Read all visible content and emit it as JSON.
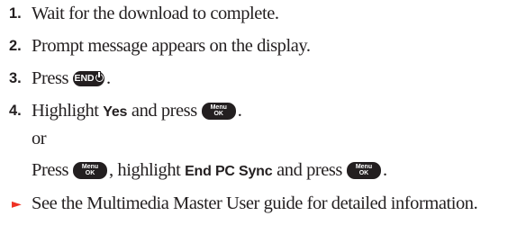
{
  "steps": [
    {
      "num": "1.",
      "text": "Wait for the download to complete."
    },
    {
      "num": "2.",
      "text": "Prompt message appears on the display."
    },
    {
      "num": "3.",
      "text_before": "Press",
      "key": "END",
      "text_after": "."
    },
    {
      "num": "4.",
      "text_before": "Highlight",
      "bold": "Yes",
      "text_mid": "and press",
      "key": "Menu OK",
      "text_after": "."
    }
  ],
  "alt": {
    "or": "or",
    "press": "Press",
    "comma_highlight": ", highlight",
    "bold": "End PC Sync",
    "and_press": "and press",
    "period": "."
  },
  "keys": {
    "end_label": "END",
    "menu_top": "Menu",
    "menu_bottom": "OK"
  },
  "note": {
    "marker_icon": "triangle-right-icon",
    "marker_color": "#ee3124",
    "text": "See the Multimedia Master User guide for detailed information."
  }
}
